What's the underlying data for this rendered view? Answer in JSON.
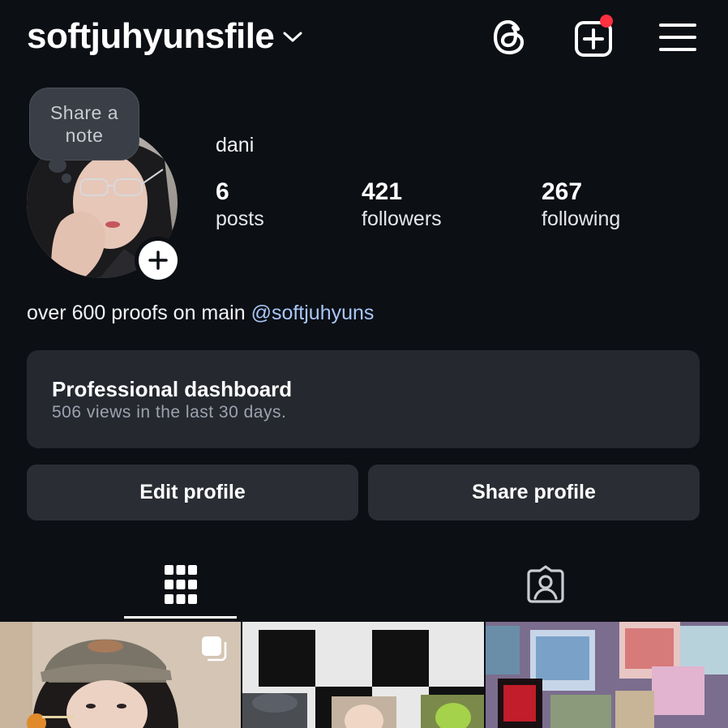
{
  "header": {
    "username": "softjuhyunsfile",
    "icons": [
      "chevron-down-icon",
      "threads-icon",
      "new-post-icon",
      "menu-icon"
    ],
    "notification_dot_color": "#ff3040"
  },
  "note": {
    "line1": "Share a",
    "line2": "note"
  },
  "profile": {
    "display_name": "dani",
    "stats": [
      {
        "value": "6",
        "label": "posts"
      },
      {
        "value": "421",
        "label": "followers"
      },
      {
        "value": "267",
        "label": "following"
      }
    ],
    "bio_text": "over 600 proofs on main ",
    "bio_link": "@softjuhyuns"
  },
  "dashboard": {
    "title": "Professional dashboard",
    "subtitle": "506 views in the last 30 days."
  },
  "buttons": {
    "edit": "Edit profile",
    "share": "Share profile"
  },
  "tabs": [
    {
      "icon": "grid-icon",
      "selected": true
    },
    {
      "icon": "tagged-icon",
      "selected": false
    }
  ],
  "colors": {
    "background": "#0c0f14",
    "surface": "#25282f",
    "link": "#a8c7fa"
  }
}
